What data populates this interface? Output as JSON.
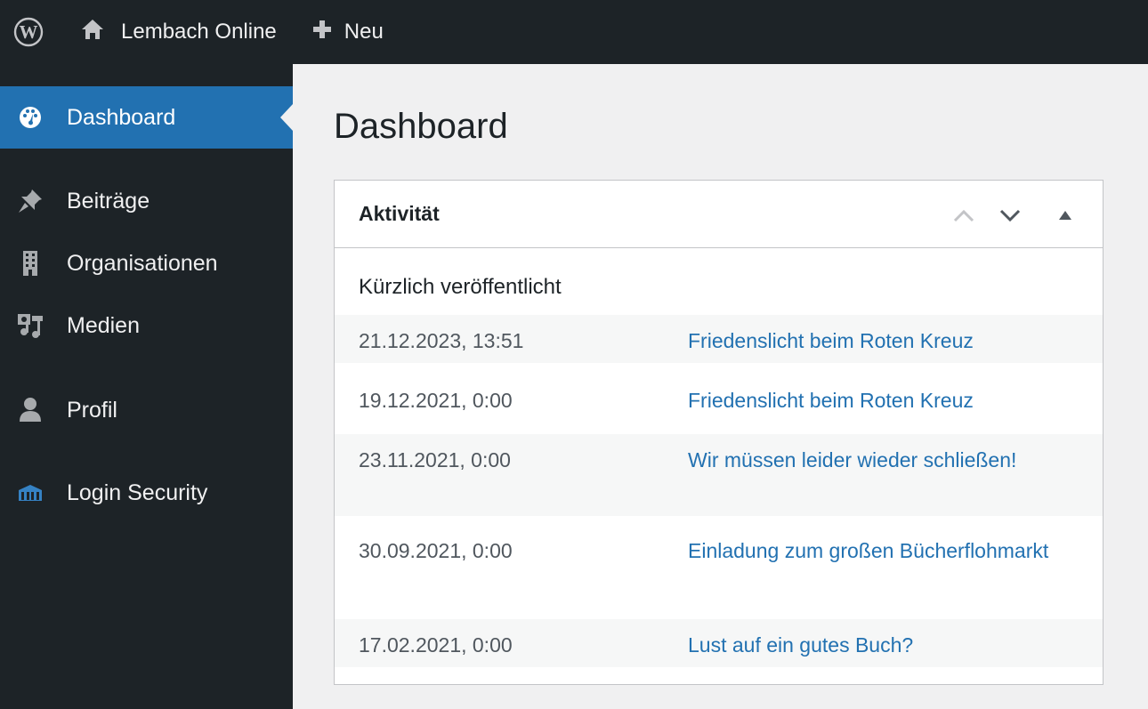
{
  "adminbar": {
    "site_name": "Lembach Online",
    "new_label": "Neu"
  },
  "sidebar": {
    "items": [
      {
        "label": "Dashboard",
        "icon": "dashboard-icon"
      },
      {
        "label": "Beiträge",
        "icon": "pin-icon"
      },
      {
        "label": "Organisationen",
        "icon": "building-icon"
      },
      {
        "label": "Medien",
        "icon": "media-icon"
      },
      {
        "label": "Profil",
        "icon": "user-icon"
      },
      {
        "label": "Login Security",
        "icon": "shield-building-icon"
      }
    ]
  },
  "main": {
    "title": "Dashboard",
    "activity": {
      "title": "Aktivität",
      "subtitle": "Kürzlich veröffentlicht",
      "posts": [
        {
          "date": "21.12.2023, 13:51",
          "title": "Friedenslicht beim Roten Kreuz"
        },
        {
          "date": "19.12.2021, 0:00",
          "title": "Friedenslicht beim Roten Kreuz"
        },
        {
          "date": "23.11.2021, 0:00",
          "title": "Wir müssen leider wieder schließen!"
        },
        {
          "date": "30.09.2021, 0:00",
          "title": "Einladung zum großen Bücherflohmarkt"
        },
        {
          "date": "17.02.2021, 0:00",
          "title": "Lust auf ein gutes Buch?"
        }
      ]
    }
  },
  "colors": {
    "accent": "#2271b1",
    "sidebar_bg": "#1d2327",
    "page_bg": "#f0f0f1"
  }
}
